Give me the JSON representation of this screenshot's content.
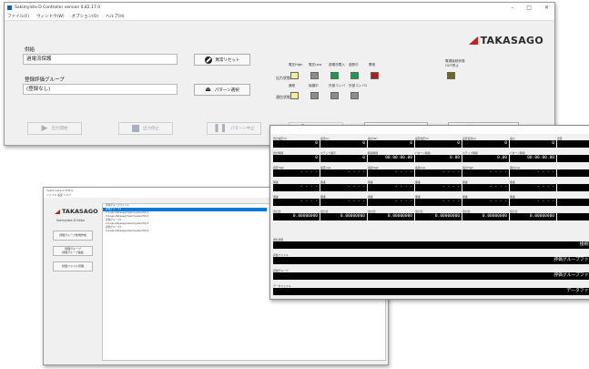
{
  "colors": {
    "sel_blue": "#0078d7",
    "logo_red": "#c8201e",
    "yellow": "#f2ec9c",
    "gray": "#8c8c8c",
    "green": "#1a9a4a",
    "red": "#b01c20",
    "olive": "#6a6a20"
  },
  "win1": {
    "title": "Sakimyiste-D Controller  version 0.82.17.0",
    "menu": [
      "ファイル(F)",
      "ウィンドウ(W)",
      "オプション(O)",
      "ヘルプ(H)"
    ],
    "test_name_label": "供給",
    "test_name_value": "過電流保護",
    "eval_group_label": "登録評価グループ",
    "eval_group_value": "(登録なし)",
    "btn_error_reset": "異常リセット",
    "btn_pattern_select": "パターン選択",
    "logo": "TAKASAGO",
    "row1_label": "出力状態",
    "row2_label": "通信状態",
    "indicators_top": [
      {
        "label": "電圧High",
        "color": "#f2ec9c"
      },
      {
        "label": "電圧Low",
        "color": "#8c8c8c"
      },
      {
        "label": "過電流電入",
        "color": "#1a9a4a"
      },
      {
        "label": "過熱中",
        "color": "#1a9a4a"
      },
      {
        "label": "異常",
        "color": "#b01c20"
      }
    ],
    "indicators_bottom": [
      {
        "label": "通常",
        "color": "#f2ec9c"
      },
      {
        "label": "保護中",
        "color": "#8c8c8c"
      },
      {
        "label": "外部コンバ",
        "color": "#8c8c8c"
      },
      {
        "label": "外部コンバ2",
        "color": "#8c8c8c"
      }
    ],
    "extra_indicator": {
      "label": "電源接続状態\nOUT停止",
      "color": "#6a6a20"
    },
    "toolbar": [
      "出力開始",
      "出力停止",
      "パターン中止",
      "出力再開",
      "パターン実行",
      "ステップ実行"
    ]
  },
  "win2": {
    "title": "",
    "rows": [
      {
        "caps": [
          "出力電圧(V)",
          "電流(A)",
          "電力(W)",
          "設定電圧(V)",
          "設定電流(A)",
          "電力",
          "温度"
        ],
        "vals": [
          "0",
          "0",
          "0",
          "0",
          "0",
          "0",
          "- - -"
        ]
      },
      {
        "caps": [
          "出力時間",
          "ステップ番号",
          "経過時間",
          "パターン時間",
          "ステップ時間",
          "パターン時間",
          ""
        ],
        "vals": [
          "0",
          "0",
          "00:00:00.00",
          "0.00",
          "0.00",
          "00:00:00.00",
          "- - -"
        ]
      },
      {
        "caps": [
          "電圧High",
          "電圧Low",
          "電流High",
          "電流Low",
          "電力High",
          "電力Low",
          ""
        ],
        "vals": [
          "- - - -",
          "- - - -",
          "- - - -",
          "- - - -",
          "- - - -",
          "- - - -",
          "- - -"
        ]
      },
      {
        "caps": [
          "保護",
          "保護",
          "保護",
          "保護",
          "保護",
          "保護",
          ""
        ],
        "vals": [
          "- - - -",
          "- - - -",
          "- - - -",
          "- - - -",
          "- - - -",
          "- - - -",
          "- - -"
        ]
      },
      {
        "caps": [
          "保護",
          "保護",
          "保護",
          "保護",
          "保護",
          "保護",
          ""
        ],
        "vals": [
          "- - - -",
          "- - - -",
          "- - - -",
          "- - - -",
          "- - - -",
          "- - - -",
          "- - -"
        ]
      },
      {
        "caps": [
          "出力比",
          "出力比",
          "出力比",
          "出力比",
          "出力比",
          "出力比",
          ""
        ],
        "vals": [
          "0.00000000",
          "0.00000000",
          "0.00000000",
          "0.00000000",
          "0.00000000",
          "0.00000000",
          "- - -"
        ]
      }
    ],
    "wide_rows": [
      {
        "cap": "通信状態",
        "val": "接続なし"
      },
      {
        "cap": "評価ファイル",
        "val": "評価グループファイル"
      },
      {
        "cap": "評価グループ",
        "val": "評価グループファイル"
      },
      {
        "cap": "データファイル",
        "val": "データファイル"
      }
    ]
  },
  "win3": {
    "title": "Sakimyiste-D Editor",
    "menu": "ファイル  編集  ヘルプ",
    "logo": "TAKASAGO",
    "app_name": "Sakimyiste-D Editor",
    "buttons": [
      "評価グループ新規作成",
      "評価グループ\n評価グループ編集",
      "評価ファイル管理"
    ],
    "tree": [
      {
        "text": "評価グループファイル",
        "sel": false
      },
      {
        "text": "評価グループ1",
        "sel": true
      },
      {
        "text": "  C:\\Users\\takasago\\Sakimyiste-D\\PJ-1",
        "sel": false
      },
      {
        "text": "  C:\\Users\\takasago\\Sakimyiste-D\\PJ-2",
        "sel": false
      },
      {
        "text": "評価グループ2",
        "sel": false
      },
      {
        "text": "  C:\\Users\\takasago\\Sakimyiste-D\\PJ-3",
        "sel": false
      },
      {
        "text": "評価グループ3",
        "sel": false
      },
      {
        "text": "  C:\\Users\\takasago\\Sakimyiste-D\\PJ-4",
        "sel": false
      }
    ]
  }
}
